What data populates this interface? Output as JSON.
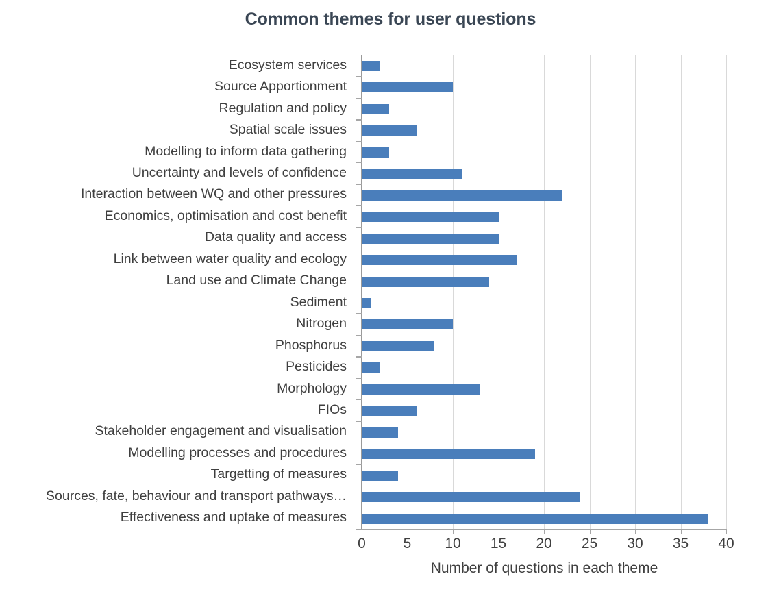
{
  "chart_data": {
    "type": "bar",
    "orientation": "horizontal",
    "title": "Common themes for user questions",
    "xlabel": "Number of questions in each theme",
    "ylabel": "",
    "xlim": [
      0,
      40
    ],
    "xticks": [
      "0",
      "5",
      "10",
      "15",
      "20",
      "25",
      "30",
      "35",
      "40"
    ],
    "xtick_values": [
      0,
      5,
      10,
      15,
      20,
      25,
      30,
      35,
      40
    ],
    "grid": "vertical",
    "legend": "none",
    "bar_color": "#4a7ebb",
    "text_color": "#3f3f3f",
    "title_color": "#3a4654",
    "gridline_color": "#d9d9d9",
    "axis_color": "#a6a6a6",
    "background": "#ffffff",
    "categories": [
      "Ecosystem services",
      "Source Apportionment",
      "Regulation and policy",
      "Spatial scale issues",
      "Modelling to inform data gathering",
      "Uncertainty and levels of confidence",
      "Interaction between WQ and other pressures",
      "Economics, optimisation and cost benefit",
      "Data quality and access",
      "Link between water quality and ecology",
      "Land use and Climate Change",
      "Sediment",
      "Nitrogen",
      "Phosphorus",
      "Pesticides",
      "Morphology",
      "FIOs",
      "Stakeholder engagement and visualisation",
      "Modelling processes and procedures",
      "Targetting of measures",
      "Sources, fate, behaviour and transport pathways…",
      "Effectiveness and uptake of measures"
    ],
    "values": [
      2,
      10,
      3,
      6,
      3,
      11,
      22,
      15,
      15,
      17,
      14,
      1,
      10,
      8,
      2,
      13,
      6,
      4,
      19,
      4,
      24,
      38
    ]
  }
}
